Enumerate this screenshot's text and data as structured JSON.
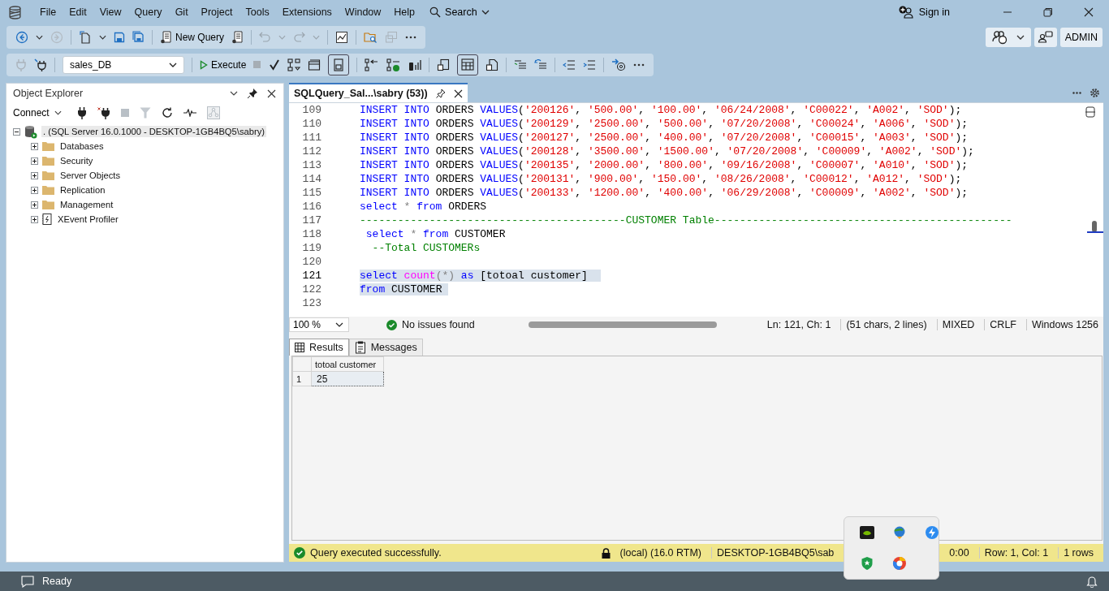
{
  "menu": [
    {
      "label": "File"
    },
    {
      "label": "Edit"
    },
    {
      "label": "View"
    },
    {
      "label": "Query"
    },
    {
      "label": "Git"
    },
    {
      "label": "Project"
    },
    {
      "label": "Tools"
    },
    {
      "label": "Extensions"
    },
    {
      "label": "Window"
    },
    {
      "label": "Help"
    }
  ],
  "search": {
    "label": "Search"
  },
  "account": {
    "sign_in": "Sign in",
    "user": "ADMIN"
  },
  "toolbar": {
    "new_query": "New Query",
    "database": "sales_DB",
    "execute": "Execute"
  },
  "object_explorer": {
    "title": "Object Explorer",
    "connect": "Connect",
    "tree": [
      {
        "label": ". (SQL Server 16.0.1000 - DESKTOP-1GB4BQ5\\sabry)",
        "kind": "server",
        "expanded": true,
        "selected": true,
        "children": [
          {
            "label": "Databases",
            "kind": "folder",
            "expanded": false,
            "selected": false
          },
          {
            "label": "Security",
            "kind": "folder",
            "expanded": false,
            "selected": false
          },
          {
            "label": "Server Objects",
            "kind": "folder",
            "expanded": false,
            "selected": false
          },
          {
            "label": "Replication",
            "kind": "folder",
            "expanded": false,
            "selected": false
          },
          {
            "label": "Management",
            "kind": "folder",
            "expanded": false,
            "selected": false
          },
          {
            "label": "XEvent Profiler",
            "kind": "profiler",
            "expanded": false,
            "selected": false
          }
        ]
      }
    ]
  },
  "document_tabs": [
    {
      "label": "SQLQuery_Sal...\\sabry (53))",
      "selected": true
    }
  ],
  "editor": {
    "lines": [
      {
        "number": "109",
        "current": false,
        "highlighted": false,
        "tokens": [
          {
            "kind": "keyword",
            "text": "INSERT INTO"
          },
          {
            "kind": "plain",
            "text": " ORDERS "
          },
          {
            "kind": "keyword",
            "text": "VALUES"
          },
          {
            "kind": "plain",
            "text": "("
          },
          {
            "kind": "string",
            "text": "'200126'"
          },
          {
            "kind": "plain",
            "text": ", "
          },
          {
            "kind": "string",
            "text": "'500.00'"
          },
          {
            "kind": "plain",
            "text": ", "
          },
          {
            "kind": "string",
            "text": "'100.00'"
          },
          {
            "kind": "plain",
            "text": ", "
          },
          {
            "kind": "string",
            "text": "'06/24/2008'"
          },
          {
            "kind": "plain",
            "text": ", "
          },
          {
            "kind": "string",
            "text": "'C00022'"
          },
          {
            "kind": "plain",
            "text": ", "
          },
          {
            "kind": "string",
            "text": "'A002'"
          },
          {
            "kind": "plain",
            "text": ", "
          },
          {
            "kind": "string",
            "text": "'SOD'"
          },
          {
            "kind": "plain",
            "text": ");"
          }
        ]
      },
      {
        "number": "110",
        "current": false,
        "highlighted": false,
        "tokens": [
          {
            "kind": "keyword",
            "text": "INSERT INTO"
          },
          {
            "kind": "plain",
            "text": " ORDERS "
          },
          {
            "kind": "keyword",
            "text": "VALUES"
          },
          {
            "kind": "plain",
            "text": "("
          },
          {
            "kind": "string",
            "text": "'200129'"
          },
          {
            "kind": "plain",
            "text": ", "
          },
          {
            "kind": "string",
            "text": "'2500.00'"
          },
          {
            "kind": "plain",
            "text": ", "
          },
          {
            "kind": "string",
            "text": "'500.00'"
          },
          {
            "kind": "plain",
            "text": ", "
          },
          {
            "kind": "string",
            "text": "'07/20/2008'"
          },
          {
            "kind": "plain",
            "text": ", "
          },
          {
            "kind": "string",
            "text": "'C00024'"
          },
          {
            "kind": "plain",
            "text": ", "
          },
          {
            "kind": "string",
            "text": "'A006'"
          },
          {
            "kind": "plain",
            "text": ", "
          },
          {
            "kind": "string",
            "text": "'SOD'"
          },
          {
            "kind": "plain",
            "text": ");"
          }
        ]
      },
      {
        "number": "111",
        "current": false,
        "highlighted": false,
        "tokens": [
          {
            "kind": "keyword",
            "text": "INSERT INTO"
          },
          {
            "kind": "plain",
            "text": " ORDERS "
          },
          {
            "kind": "keyword",
            "text": "VALUES"
          },
          {
            "kind": "plain",
            "text": "("
          },
          {
            "kind": "string",
            "text": "'200127'"
          },
          {
            "kind": "plain",
            "text": ", "
          },
          {
            "kind": "string",
            "text": "'2500.00'"
          },
          {
            "kind": "plain",
            "text": ", "
          },
          {
            "kind": "string",
            "text": "'400.00'"
          },
          {
            "kind": "plain",
            "text": ", "
          },
          {
            "kind": "string",
            "text": "'07/20/2008'"
          },
          {
            "kind": "plain",
            "text": ", "
          },
          {
            "kind": "string",
            "text": "'C00015'"
          },
          {
            "kind": "plain",
            "text": ", "
          },
          {
            "kind": "string",
            "text": "'A003'"
          },
          {
            "kind": "plain",
            "text": ", "
          },
          {
            "kind": "string",
            "text": "'SOD'"
          },
          {
            "kind": "plain",
            "text": ");"
          }
        ]
      },
      {
        "number": "112",
        "current": false,
        "highlighted": false,
        "tokens": [
          {
            "kind": "keyword",
            "text": "INSERT INTO"
          },
          {
            "kind": "plain",
            "text": " ORDERS "
          },
          {
            "kind": "keyword",
            "text": "VALUES"
          },
          {
            "kind": "plain",
            "text": "("
          },
          {
            "kind": "string",
            "text": "'200128'"
          },
          {
            "kind": "plain",
            "text": ", "
          },
          {
            "kind": "string",
            "text": "'3500.00'"
          },
          {
            "kind": "plain",
            "text": ", "
          },
          {
            "kind": "string",
            "text": "'1500.00'"
          },
          {
            "kind": "plain",
            "text": ", "
          },
          {
            "kind": "string",
            "text": "'07/20/2008'"
          },
          {
            "kind": "plain",
            "text": ", "
          },
          {
            "kind": "string",
            "text": "'C00009'"
          },
          {
            "kind": "plain",
            "text": ", "
          },
          {
            "kind": "string",
            "text": "'A002'"
          },
          {
            "kind": "plain",
            "text": ", "
          },
          {
            "kind": "string",
            "text": "'SOD'"
          },
          {
            "kind": "plain",
            "text": ");"
          }
        ]
      },
      {
        "number": "113",
        "current": false,
        "highlighted": false,
        "tokens": [
          {
            "kind": "keyword",
            "text": "INSERT INTO"
          },
          {
            "kind": "plain",
            "text": " ORDERS "
          },
          {
            "kind": "keyword",
            "text": "VALUES"
          },
          {
            "kind": "plain",
            "text": "("
          },
          {
            "kind": "string",
            "text": "'200135'"
          },
          {
            "kind": "plain",
            "text": ", "
          },
          {
            "kind": "string",
            "text": "'2000.00'"
          },
          {
            "kind": "plain",
            "text": ", "
          },
          {
            "kind": "string",
            "text": "'800.00'"
          },
          {
            "kind": "plain",
            "text": ", "
          },
          {
            "kind": "string",
            "text": "'09/16/2008'"
          },
          {
            "kind": "plain",
            "text": ", "
          },
          {
            "kind": "string",
            "text": "'C00007'"
          },
          {
            "kind": "plain",
            "text": ", "
          },
          {
            "kind": "string",
            "text": "'A010'"
          },
          {
            "kind": "plain",
            "text": ", "
          },
          {
            "kind": "string",
            "text": "'SOD'"
          },
          {
            "kind": "plain",
            "text": ");"
          }
        ]
      },
      {
        "number": "114",
        "current": false,
        "highlighted": false,
        "tokens": [
          {
            "kind": "keyword",
            "text": "INSERT INTO"
          },
          {
            "kind": "plain",
            "text": " ORDERS "
          },
          {
            "kind": "keyword",
            "text": "VALUES"
          },
          {
            "kind": "plain",
            "text": "("
          },
          {
            "kind": "string",
            "text": "'200131'"
          },
          {
            "kind": "plain",
            "text": ", "
          },
          {
            "kind": "string",
            "text": "'900.00'"
          },
          {
            "kind": "plain",
            "text": ", "
          },
          {
            "kind": "string",
            "text": "'150.00'"
          },
          {
            "kind": "plain",
            "text": ", "
          },
          {
            "kind": "string",
            "text": "'08/26/2008'"
          },
          {
            "kind": "plain",
            "text": ", "
          },
          {
            "kind": "string",
            "text": "'C00012'"
          },
          {
            "kind": "plain",
            "text": ", "
          },
          {
            "kind": "string",
            "text": "'A012'"
          },
          {
            "kind": "plain",
            "text": ", "
          },
          {
            "kind": "string",
            "text": "'SOD'"
          },
          {
            "kind": "plain",
            "text": ");"
          }
        ]
      },
      {
        "number": "115",
        "current": false,
        "highlighted": false,
        "tokens": [
          {
            "kind": "keyword",
            "text": "INSERT INTO"
          },
          {
            "kind": "plain",
            "text": " ORDERS "
          },
          {
            "kind": "keyword",
            "text": "VALUES"
          },
          {
            "kind": "plain",
            "text": "("
          },
          {
            "kind": "string",
            "text": "'200133'"
          },
          {
            "kind": "plain",
            "text": ", "
          },
          {
            "kind": "string",
            "text": "'1200.00'"
          },
          {
            "kind": "plain",
            "text": ", "
          },
          {
            "kind": "string",
            "text": "'400.00'"
          },
          {
            "kind": "plain",
            "text": ", "
          },
          {
            "kind": "string",
            "text": "'06/29/2008'"
          },
          {
            "kind": "plain",
            "text": ", "
          },
          {
            "kind": "string",
            "text": "'C00009'"
          },
          {
            "kind": "plain",
            "text": ", "
          },
          {
            "kind": "string",
            "text": "'A002'"
          },
          {
            "kind": "plain",
            "text": ", "
          },
          {
            "kind": "string",
            "text": "'SOD'"
          },
          {
            "kind": "plain",
            "text": ");"
          }
        ]
      },
      {
        "number": "116",
        "current": false,
        "highlighted": false,
        "tokens": [
          {
            "kind": "keyword",
            "text": "select"
          },
          {
            "kind": "operator",
            "text": " * "
          },
          {
            "kind": "keyword",
            "text": "from"
          },
          {
            "kind": "plain",
            "text": " ORDERS"
          }
        ]
      },
      {
        "number": "117",
        "current": false,
        "highlighted": false,
        "tokens": [
          {
            "kind": "comment",
            "text": "------------------------------------------CUSTOMER Table-----------------------------------------------"
          }
        ]
      },
      {
        "number": "118",
        "current": false,
        "highlighted": false,
        "tokens": [
          {
            "kind": "keyword",
            "text": " select"
          },
          {
            "kind": "operator",
            "text": " * "
          },
          {
            "kind": "keyword",
            "text": "from"
          },
          {
            "kind": "plain",
            "text": " CUSTOMER"
          }
        ]
      },
      {
        "number": "119",
        "current": false,
        "highlighted": false,
        "tokens": [
          {
            "kind": "comment",
            "text": "  --Total CUSTOMERs"
          }
        ]
      },
      {
        "number": "120",
        "current": false
      },
      {
        "number": "121",
        "current": true,
        "highlighted": true,
        "tokens": [
          {
            "kind": "keyword",
            "text": "select"
          },
          {
            "kind": "function",
            "text": " count"
          },
          {
            "kind": "operator",
            "text": "(*)"
          },
          {
            "kind": "keyword",
            "text": " as"
          },
          {
            "kind": "plain",
            "text": " [totoal customer] "
          }
        ]
      },
      {
        "number": "122",
        "current": false,
        "highlighted": true,
        "tokens": [
          {
            "kind": "keyword",
            "text": "from"
          },
          {
            "kind": "plain",
            "text": " CUSTOMER"
          }
        ]
      },
      {
        "number": "123",
        "current": false
      }
    ]
  },
  "editor_status": {
    "zoom": "100 %",
    "issues": "No issues found",
    "position": "Ln: 121, Ch: 1",
    "selection": "(51 chars, 2 lines)",
    "mode": "MIXED",
    "line_endings": "CRLF",
    "encoding": "Windows 1256"
  },
  "result_tabs": [
    {
      "label": "Results",
      "kind": "grid",
      "selected": true
    },
    {
      "label": "Messages",
      "kind": "messages",
      "selected": false
    }
  ],
  "results": {
    "columns": [
      "totoal customer"
    ],
    "rows": [
      {
        "number": "1",
        "cells": [
          "25"
        ]
      }
    ]
  },
  "query_status": {
    "message": "Query executed successfully.",
    "server": "(local) (16.0 RTM)",
    "connection": "DESKTOP-1GB4BQ5\\sab",
    "time": "0:00",
    "cursor": "Row: 1, Col: 1",
    "rows": "1 rows"
  },
  "status_bar": {
    "text": "Ready"
  }
}
